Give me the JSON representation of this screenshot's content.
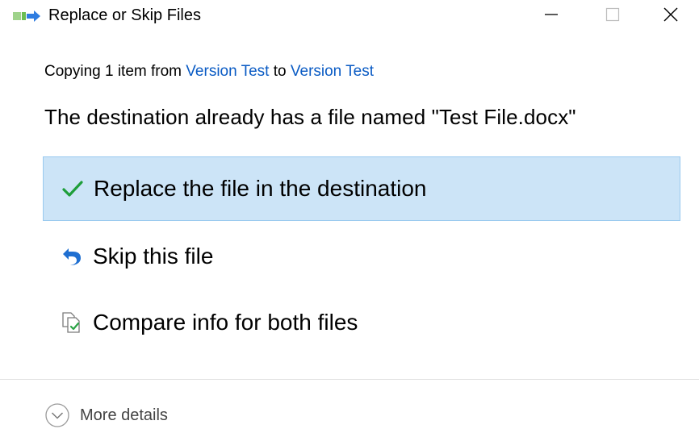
{
  "window": {
    "title": "Replace or Skip Files",
    "title_icon": "file-move-icon",
    "controls": {
      "minimize_icon": "minimize-icon",
      "maximize_icon": "maximize-icon",
      "close_icon": "close-icon"
    }
  },
  "copy_status": {
    "prefix": "Copying 1 item from",
    "source": "Version Test",
    "connector": "to",
    "destination": "Version Test"
  },
  "message": "The destination already has a file named \"Test File.docx\"",
  "options": [
    {
      "label": "Replace the file in the destination",
      "icon": "checkmark-icon",
      "selected": true
    },
    {
      "label": "Skip this file",
      "icon": "skip-arrow-icon",
      "selected": false
    },
    {
      "label": "Compare info for both files",
      "icon": "compare-files-icon",
      "selected": false
    }
  ],
  "footer": {
    "more_details_label": "More details",
    "more_details_icon": "chevron-down-circle-icon"
  },
  "colors": {
    "link": "#0a5bc4",
    "selected_bg": "#cce4f7",
    "selected_border": "#99c9ef",
    "checkmark": "#1e9e3a",
    "skip_icon": "#1f6fd1"
  }
}
